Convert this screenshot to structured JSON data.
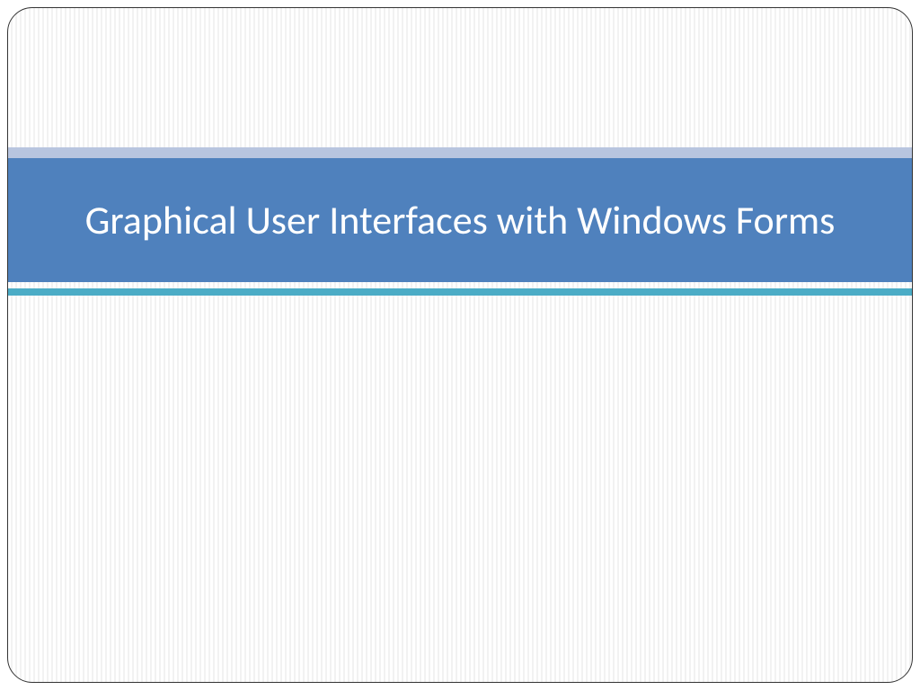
{
  "slide": {
    "title": "Graphical User Interfaces with Windows Forms"
  },
  "colors": {
    "title_band": "#4f81bd",
    "top_accent": "#b8c5df",
    "bottom_accent": "#4bacc6"
  }
}
